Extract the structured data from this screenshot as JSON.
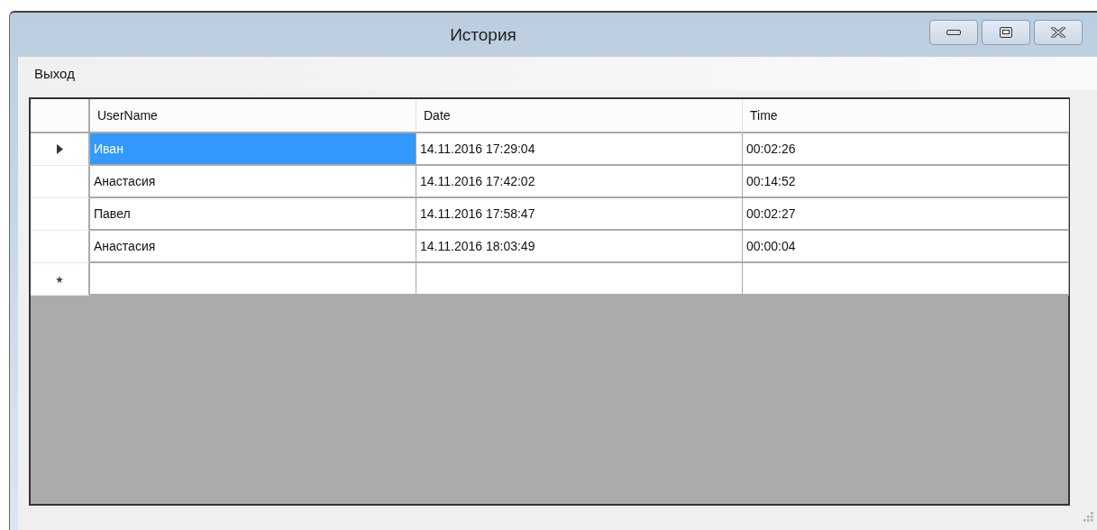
{
  "window": {
    "title": "История"
  },
  "menu": [
    "Выход"
  ],
  "table": {
    "columns": [
      "UserName",
      "Date",
      "Time"
    ],
    "rows": [
      {
        "kind": "data",
        "current": true,
        "cells": [
          {
            "text": "Иван",
            "selected": true
          },
          {
            "text": "14.11.2016 17:29:04",
            "selected": false
          },
          {
            "text": "00:02:26",
            "selected": false
          }
        ]
      },
      {
        "kind": "data",
        "current": false,
        "cells": [
          {
            "text": "Анастасия",
            "selected": false
          },
          {
            "text": "14.11.2016 17:42:02",
            "selected": false
          },
          {
            "text": "00:14:52",
            "selected": false
          }
        ]
      },
      {
        "kind": "data",
        "current": false,
        "cells": [
          {
            "text": "Павел",
            "selected": false
          },
          {
            "text": "14.11.2016 17:58:47",
            "selected": false
          },
          {
            "text": "00:02:27",
            "selected": false
          }
        ]
      },
      {
        "kind": "data",
        "current": false,
        "cells": [
          {
            "text": "Анастасия",
            "selected": false
          },
          {
            "text": "14.11.2016 18:03:49",
            "selected": false
          },
          {
            "text": "00:00:04",
            "selected": false
          }
        ]
      },
      {
        "kind": "new",
        "current": false
      }
    ]
  }
}
